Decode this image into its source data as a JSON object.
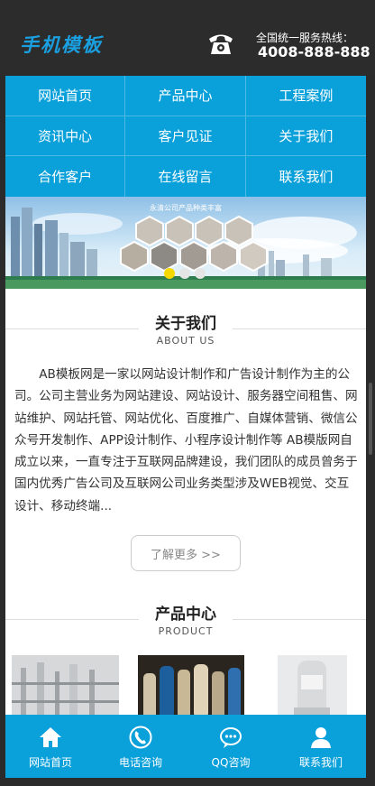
{
  "header": {
    "logo": "手机模板",
    "hotline_label": "全国统一服务热线：",
    "hotline_number": "4008-888-888",
    "phone_icon": "telephone-icon"
  },
  "nav": {
    "items": [
      {
        "label": "网站首页"
      },
      {
        "label": "产品中心"
      },
      {
        "label": "工程案例"
      },
      {
        "label": "资讯中心"
      },
      {
        "label": "客户见证"
      },
      {
        "label": "关于我们"
      },
      {
        "label": "合作客户"
      },
      {
        "label": "在线留言"
      },
      {
        "label": "联系我们"
      }
    ]
  },
  "banner": {
    "caption": "永清公司产品种类丰富",
    "slides": 3,
    "active_slide": 1
  },
  "about": {
    "title": "关于我们",
    "subtitle": "ABOUT US",
    "text": "AB模板网是一家以网站设计制作和广告设计制作为主的公司。公司主营业务为网站建设、网站设计、服务器空间租售、网站维护、网站托管、网站优化、百度推广、自媒体营销、微信公众号开发制作、APP设计制作、小程序设计制作等 AB模版网自成立以来，一直专注于互联网品牌建设，我们团队的成员曾务于国内优秀广告公司及互联网公司业务类型涉及WEB视觉、交互设计、移动终端...",
    "more_label": "了解更多 >>"
  },
  "products": {
    "title": "产品中心",
    "subtitle": "PRODUCT"
  },
  "footer": {
    "items": [
      {
        "label": "网站首页",
        "icon": "home-icon"
      },
      {
        "label": "电话咨询",
        "icon": "phone-icon"
      },
      {
        "label": "QQ咨询",
        "icon": "chat-icon"
      },
      {
        "label": "联系我们",
        "icon": "user-icon"
      }
    ]
  },
  "colors": {
    "brand": "#0aa0d9",
    "header_bg": "#2c2c2c",
    "logo": "#1a9fe0"
  }
}
